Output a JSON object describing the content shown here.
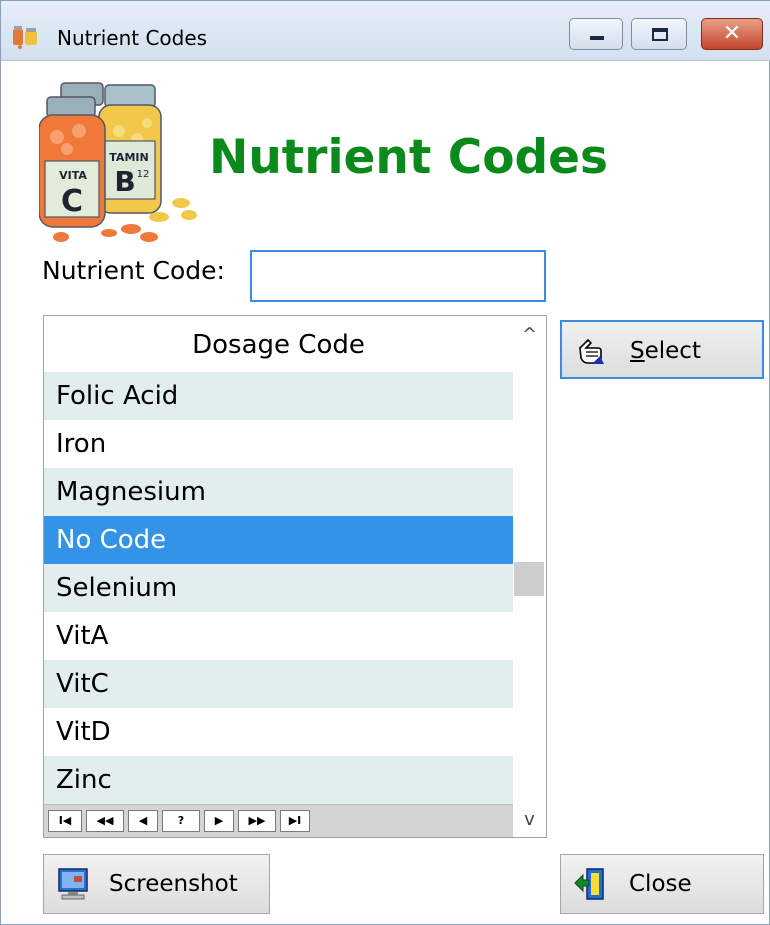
{
  "window": {
    "title": "Nutrient Codes",
    "controls": {
      "minimize": "minimize",
      "maximize": "maximize",
      "close": "✕"
    }
  },
  "header": {
    "heading": "Nutrient Codes",
    "logo_icon": "vitamin-bottles-icon",
    "logo_labels": {
      "bottle_c": "C",
      "bottle_c_text": "VITA",
      "bottle_b": "B",
      "bottle_b_sup": "12",
      "bottle_b_text": "TAMIN"
    }
  },
  "form": {
    "nutrient_code_label": "Nutrient Code:",
    "nutrient_code_value": ""
  },
  "grid": {
    "column_header": "Dosage Code",
    "rows": [
      "Folic Acid",
      "Iron",
      "Magnesium",
      "No Code",
      "Selenium",
      "VitA",
      "VitC",
      "VitD",
      "Zinc"
    ],
    "selected_row": "No Code",
    "scrollbar": {
      "up": "^",
      "down": "v"
    },
    "navigator": [
      "I◀",
      "◀◀",
      "◀",
      "?",
      "▶",
      "▶▶",
      "▶I"
    ]
  },
  "buttons": {
    "select": {
      "mnemonic": "S",
      "rest": "elect",
      "icon": "pointing-hand-icon"
    },
    "screenshot": {
      "label": "Screenshot",
      "icon": "monitor-icon"
    },
    "close": {
      "label": "Close",
      "icon": "exit-door-icon"
    }
  },
  "colors": {
    "heading": "#0a8a1a",
    "selection": "#3393e6",
    "focus_border": "#3c8be0",
    "row_alt": "#e2eeed"
  }
}
